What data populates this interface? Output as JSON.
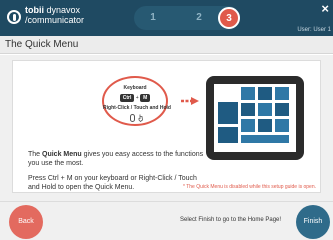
{
  "header": {
    "brand_bold": "tobii",
    "brand_rest": " dynavox",
    "brand_sub": "/communicator",
    "steps": [
      "1",
      "2",
      "3"
    ],
    "close_glyph": "×",
    "user_label": "User: User 1"
  },
  "page": {
    "title": "The Quick Menu"
  },
  "illustration": {
    "keyboard_label": "Keyboard",
    "key_ctrl": "Ctrl",
    "key_plus": "+",
    "key_m": "M",
    "or_label": "Right-Click / Touch and Hold",
    "icons": [
      "mouse-icon",
      "hand-icon",
      "arrow-right-icon",
      "tablet-icon"
    ]
  },
  "content": {
    "desc_pre": "The ",
    "desc_bold": "Quick Menu",
    "desc_post": " gives you easy access to the functions you use the most.",
    "instructions": "Press Ctrl + M on your keyboard or Right-Click / Touch and Hold to open the Quick Menu.",
    "note": "* The Quick Menu is disabled while this setup guide is open."
  },
  "footer": {
    "back_label": "Back",
    "message": "Select Finish to go to the Home Page!",
    "finish_label": "Finish"
  },
  "colors": {
    "header_bg": "#1f4a62",
    "accent_red": "#e05a4b",
    "finish_blue": "#2f6b8a",
    "tile_blue": "#1f5b82"
  }
}
